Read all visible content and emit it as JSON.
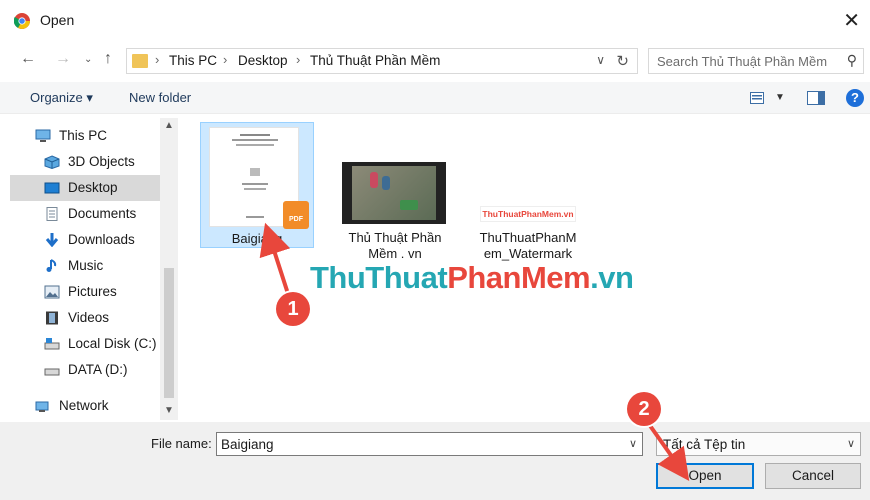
{
  "window": {
    "title": "Open"
  },
  "address": {
    "crumbs": [
      "This PC",
      "Desktop",
      "Thủ Thuật Phần Mềm"
    ],
    "search_placeholder": "Search Thủ Thuật Phần Mềm"
  },
  "toolbar": {
    "organize": "Organize",
    "new_folder": "New folder",
    "help": "?"
  },
  "sidebar": {
    "items": [
      {
        "label": "This PC",
        "icon": "computer-icon"
      },
      {
        "label": "3D Objects",
        "icon": "cube-icon"
      },
      {
        "label": "Desktop",
        "icon": "desktop-icon",
        "selected": true
      },
      {
        "label": "Documents",
        "icon": "document-icon"
      },
      {
        "label": "Downloads",
        "icon": "download-arrow-icon"
      },
      {
        "label": "Music",
        "icon": "music-note-icon"
      },
      {
        "label": "Pictures",
        "icon": "picture-icon"
      },
      {
        "label": "Videos",
        "icon": "film-icon"
      },
      {
        "label": "Local Disk (C:)",
        "icon": "drive-icon"
      },
      {
        "label": "DATA (D:)",
        "icon": "drive-icon"
      },
      {
        "label": "Network",
        "icon": "network-icon"
      }
    ]
  },
  "files": [
    {
      "name": "Baigiang",
      "type": "pdf",
      "selected": true
    },
    {
      "name_line1": "Thủ Thuật Phần",
      "name_line2": "Mềm . vn",
      "type": "video"
    },
    {
      "name_line1": "ThuThuatPhanM",
      "name_line2": "em_Watermark",
      "type": "image",
      "thumb_text": "ThuThuatPhanMem.vn"
    }
  ],
  "bottom": {
    "file_name_label": "File name:",
    "file_name_value": "Baigiang",
    "file_type_value": "Tất cả Tệp tin",
    "open": "Open",
    "cancel": "Cancel"
  },
  "annotations": {
    "badge1": "1",
    "badge2": "2"
  },
  "watermark": {
    "part1": "ThuThuat",
    "part2": "PhanMem",
    "part3": ".vn"
  },
  "colors": {
    "accent": "#0078d7",
    "badge": "#e8473c",
    "wm_teal": "#25a7b3",
    "wm_red": "#e8473c",
    "selection": "#cce8ff"
  }
}
